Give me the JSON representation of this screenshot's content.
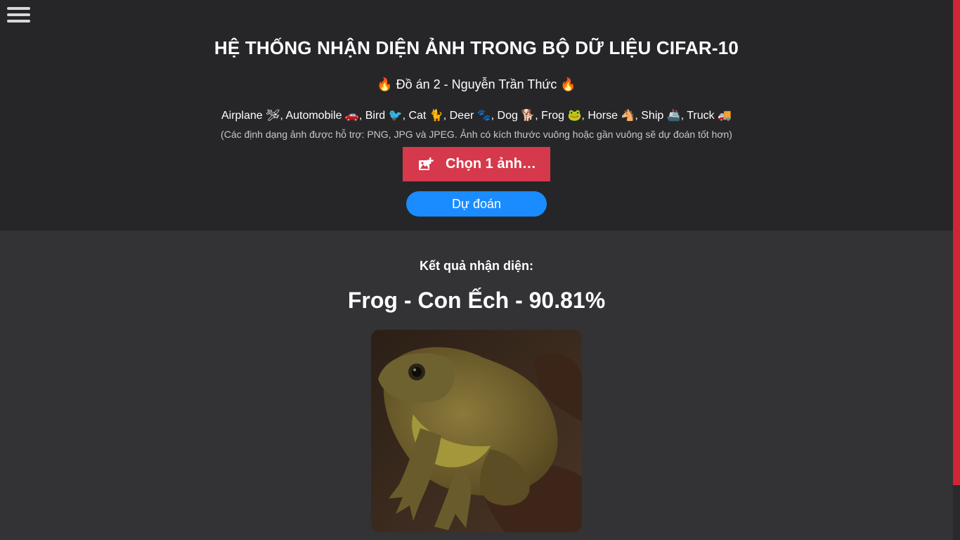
{
  "header": {
    "title": "HỆ THỐNG NHẬN DIỆN ẢNH TRONG BỘ DỮ LIỆU CIFAR-10",
    "subtitle": "🔥 Đồ án 2 - Nguyễn Trần Thức 🔥",
    "classes_line": "Airplane 🛩, Automobile 🚗, Bird 🐦, Cat 🐈, Deer 🐾, Dog 🐕, Frog 🐸, Horse 🐴, Ship 🚢, Truck 🚚",
    "note": "(Các định dạng ảnh được hỗ trợ: PNG, JPG và JPEG. Ảnh có kích thước vuông hoặc gần vuông sẽ dự đoán tốt hơn)"
  },
  "menu": {
    "icon": "hamburger-menu-icon"
  },
  "upload": {
    "label": "Chọn 1 ảnh…",
    "icon": "add-image-icon",
    "color": "#d6394c"
  },
  "predict": {
    "label": "Dự đoán",
    "color": "#1a8cff"
  },
  "result": {
    "label": "Kết quả nhận diện:",
    "text": "Frog - Con Ếch - 90.81%"
  },
  "colors": {
    "header_bg": "#262628",
    "page_bg": "#333336",
    "scrollbar_thumb": "#cf2535"
  }
}
